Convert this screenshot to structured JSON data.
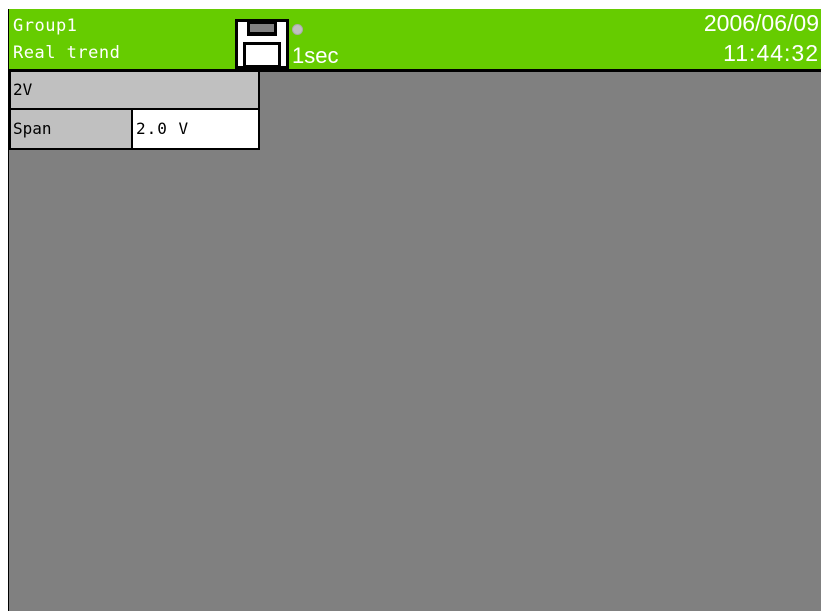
{
  "header": {
    "group_name": "Group1",
    "screen_name": "Real trend",
    "media_icon": "floppy-disk-icon",
    "access_lamp_icon": "access-lamp-icon",
    "sample_interval": "1sec",
    "date": "2006/06/09",
    "time": "11:44:32"
  },
  "channel": {
    "name": "2V",
    "span_label": "Span",
    "span_value": "2.0 V"
  },
  "colors": {
    "status_bar": "#66cc00",
    "screen_background": "#808080",
    "panel_gray": "#c0c0c0",
    "text_on_bar": "#ffffff"
  }
}
